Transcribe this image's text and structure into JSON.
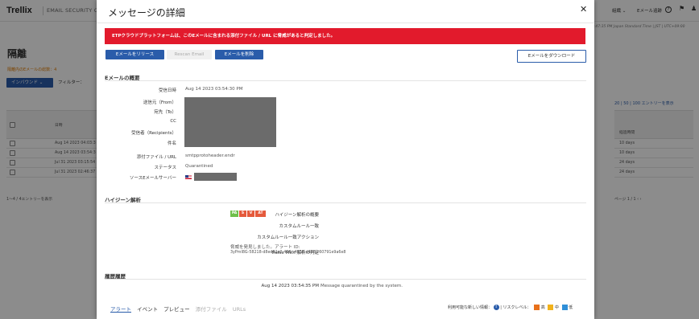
{
  "app": {
    "logo": "Trellix",
    "product": "EMAIL SECURITY C",
    "menu_label": "組織 ⌄",
    "email_tracking": "Eメール追跡",
    "help_icon": "?",
    "timezone": "3:47:35 PM Japan Standard Time | JST | UTC+09:00",
    "page_title": "隔離",
    "count_text": "隔離内のEメールの総数：4",
    "inbound_button": "インバウンド ⌄",
    "filter_label": "フィルター：",
    "date_header": "日時",
    "rows": [
      "Aug 14 2023 04:03:3",
      "Aug 14 2023 03:54:3",
      "Jul 31 2023 03:15:54",
      "Jul 31 2023 02:46:37"
    ],
    "footer": "1～4 / 4エントリーを表示",
    "per_page": "20 | 50 | 100 エントリーを表示",
    "elapsed_header": "経過時間",
    "elapsed": [
      "10 days",
      "10 days",
      "24 days",
      "24 days"
    ],
    "pager": "ページ 1 / 1  ‹  ›"
  },
  "modal": {
    "title": "メッセージの詳細",
    "close": "✕",
    "alert": "ETPクラウドプラットフォームは、このEメールに含まれる添付ファイル / URL に脅威があると判定しました。",
    "buttons": {
      "release": "Eメールをリリース",
      "rescan": "Rescan Email",
      "delete": "Eメールを削除",
      "download": "Eメールをダウンロード"
    },
    "summary": {
      "title": "Eメールの概要",
      "received_label": "受信日時",
      "received_value": "Aug 14 2023 03:54:30 PM",
      "from_label": "送信元（From）",
      "to_label": "宛先（To）",
      "cc_label": "CC",
      "recipients_label": "受信者（Recipients）",
      "subject_label": "件名",
      "attachment_label": "添付ファイル / URL",
      "attachment_value": "smtpprotoheader.endr",
      "status_label": "ステータス",
      "status_value": "Quarantined",
      "source_label": "ソースEメールサーバー"
    },
    "hygiene": {
      "title": "ハイジーン解析",
      "summary_label": "ハイジーン解析の概要",
      "badges": [
        "PA",
        "S",
        "V",
        "AT"
      ],
      "badge_colors": [
        "#6fbf4a",
        "#e55a3c",
        "#e55a3c",
        "#e55a3c"
      ],
      "rule_match_label": "カスタムルール一致",
      "rule_action_label": "カスタムルール一致アクション",
      "mvx_label": "Trellix MVX 解析の判定",
      "mvx_line1": "脅威を発見しました。アラート ID:",
      "mvx_line2": "3yPmI8G-58218-d8ed82a2-458c-4153-a478-c60791e9a6e8"
    },
    "history": {
      "title": "履歴履歴",
      "date": "Aug 14 2023 03:54:35 PM",
      "message": "Message quarantined by the system."
    },
    "tabs": [
      "アラート",
      "イベント",
      "プレビュー",
      "添付ファイル",
      "URLs"
    ],
    "risk": {
      "info_text": "利用可能な新しい情報：",
      "info_count": "!",
      "level_label": "リスクレベル：",
      "high": "高",
      "medium": "中",
      "low": "低",
      "colors": {
        "high": "#e8701a",
        "medium": "#f2b21b",
        "low": "#2f8fd8"
      }
    }
  }
}
